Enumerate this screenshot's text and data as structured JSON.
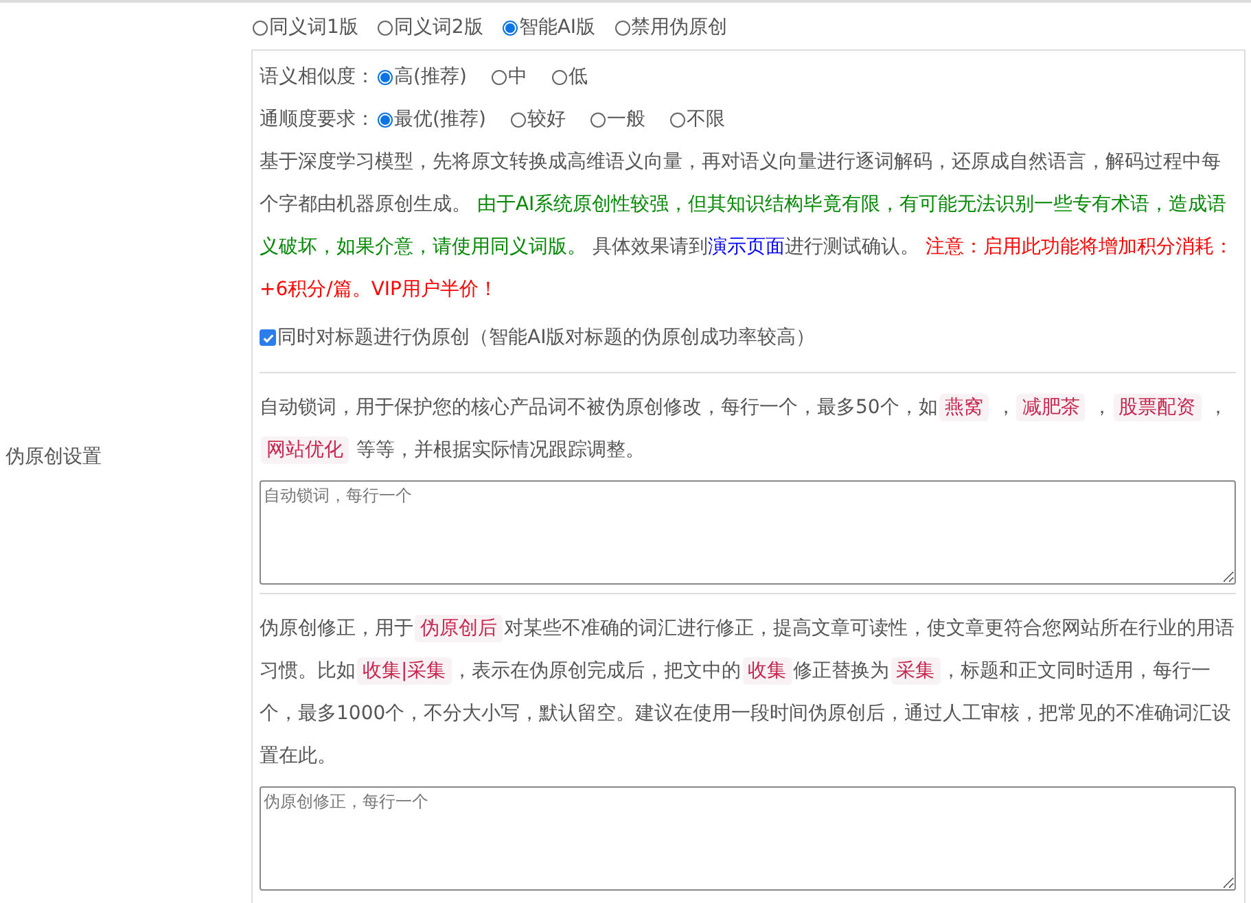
{
  "section_label": "伪原创设置",
  "modes": [
    {
      "label": "同义词1版",
      "selected": false
    },
    {
      "label": "同义词2版",
      "selected": false
    },
    {
      "label": "智能AI版",
      "selected": true
    },
    {
      "label": "禁用伪原创",
      "selected": false
    }
  ],
  "similarity": {
    "label": "语义相似度：",
    "options": [
      {
        "label": "高(推荐)",
        "selected": true
      },
      {
        "label": "中",
        "selected": false
      },
      {
        "label": "低",
        "selected": false
      }
    ]
  },
  "fluency": {
    "label": "通顺度要求：",
    "options": [
      {
        "label": "最优(推荐)",
        "selected": true
      },
      {
        "label": "较好",
        "selected": false
      },
      {
        "label": "一般",
        "selected": false
      },
      {
        "label": "不限",
        "selected": false
      }
    ]
  },
  "description": [
    {
      "kind": "plain",
      "text": "基于深度学习模型，先将原文转换成高维语义向量，再对语义向量进行逐词解码，还原成自然语言，解码过程中每个字都由机器原创生成。 "
    },
    {
      "kind": "notice",
      "text": "由于AI系统原创性较强，但其知识结构毕竟有限，有可能无法识别一些专有术语，造成语义破坏，如果介意，请使用同义词版。"
    },
    {
      "kind": "plain",
      "text": " 具体效果请到"
    },
    {
      "kind": "link",
      "text": "演示页面"
    },
    {
      "kind": "plain",
      "text": "进行测试确认。 "
    },
    {
      "kind": "warning",
      "text": "注意：启用此功能将增加积分消耗：+6积分/篇。VIP用户半价！"
    }
  ],
  "title_option": {
    "label": "同时对标题进行伪原创（智能AI版对标题的伪原创成功率较高）",
    "checked": true
  },
  "lock_words": {
    "description": [
      {
        "kind": "plain",
        "text": "自动锁词，用于保护您的核心产品词不被伪原创修改，每行一个，最多50个，如"
      },
      {
        "kind": "code",
        "text": "燕窝"
      },
      {
        "kind": "plain",
        "text": " ，"
      },
      {
        "kind": "code",
        "text": "减肥茶"
      },
      {
        "kind": "plain",
        "text": " ，"
      },
      {
        "kind": "code",
        "text": "股票配资"
      },
      {
        "kind": "plain",
        "text": " ，"
      },
      {
        "kind": "code",
        "text": "网站优化"
      },
      {
        "kind": "plain",
        "text": " 等等，并根据实际情况跟踪调整。"
      }
    ],
    "placeholder": "自动锁词，每行一个"
  },
  "corrections": {
    "description": [
      {
        "kind": "plain",
        "text": "伪原创修正，用于"
      },
      {
        "kind": "code",
        "text": "伪原创后"
      },
      {
        "kind": "plain",
        "text": "对某些不准确的词汇进行修正，提高文章可读性，使文章更符合您网站所在行业的用语习惯。比如"
      },
      {
        "kind": "code",
        "text": "收集|采集"
      },
      {
        "kind": "plain",
        "text": "，表示在伪原创完成后，把文中的"
      },
      {
        "kind": "code",
        "text": "收集"
      },
      {
        "kind": "plain",
        "text": "修正替换为"
      },
      {
        "kind": "code",
        "text": "采集"
      },
      {
        "kind": "plain",
        "text": "，标题和正文同时适用，每行一个，最多1000个，不分大小写，默认留空。建议在使用一段时间伪原创后，通过人工审核，把常见的不准确词汇设置在此。"
      }
    ],
    "placeholder": "伪原创修正，每行一个"
  }
}
